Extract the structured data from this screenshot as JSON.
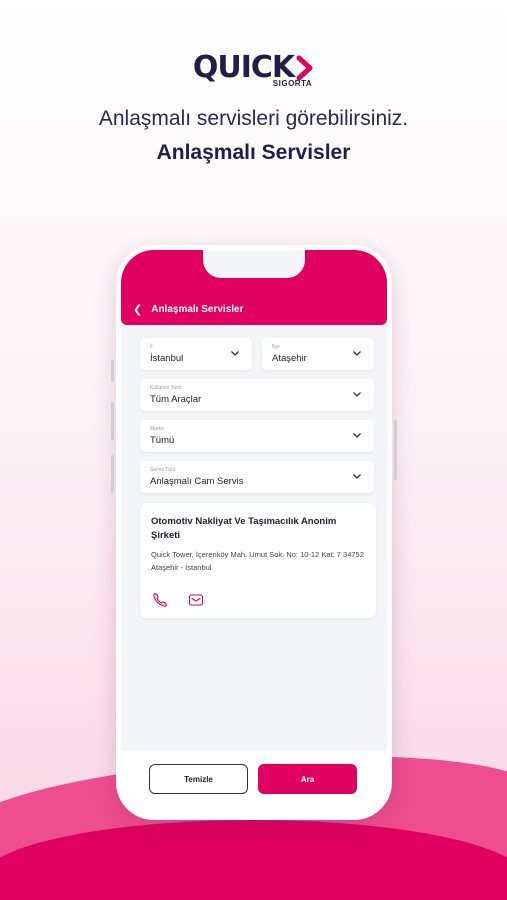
{
  "brand": {
    "name": "QUICK",
    "sub": "SIGORTA",
    "color": "#1f1f4a",
    "accent": "#e0005f"
  },
  "headline": "Anlaşmalı servisleri görebilirsiniz.",
  "subheadline": "Anlaşmalı Servisler",
  "screen": {
    "title": "Anlaşmalı Servisler",
    "back_icon": "chevron-left-icon",
    "fields": {
      "il": {
        "label": "İl",
        "value": "İstanbul"
      },
      "ilce": {
        "label": "İlçe",
        "value": "Ataşehir"
      },
      "kullanim": {
        "label": "Kullanım Tarzı",
        "value": "Tüm Araçlar"
      },
      "marka": {
        "label": "Marka",
        "value": "Tümü"
      },
      "servis": {
        "label": "Servis Türü",
        "value": "Anlaşmalı Cam Servis"
      }
    },
    "result": {
      "name": "Otomotiv Nakliyat Ve Taşımacılık Anonim Şirketi",
      "address": "Quick Tower, İçerenköy Mah. Umut Sok. No: 10-12 Kat: 7 34752 Ataşehir - İstanbul",
      "icons": [
        "phone-icon",
        "mail-icon"
      ]
    },
    "buttons": {
      "clear": "Temizle",
      "search": "Ara"
    }
  }
}
